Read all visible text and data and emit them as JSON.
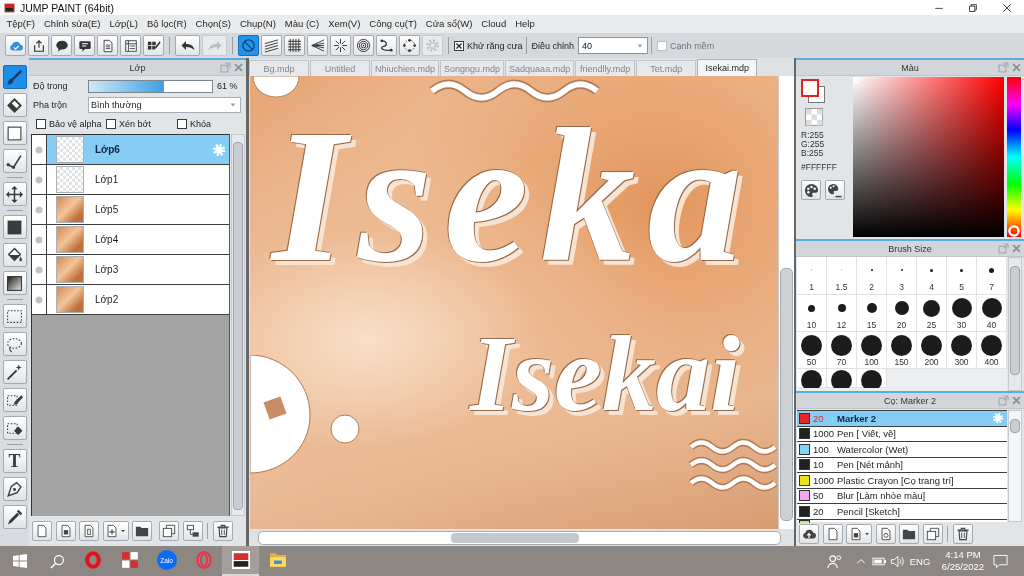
{
  "window": {
    "title": "JUMP PAINT (64bit)"
  },
  "menu": [
    "Tệp(F)",
    "Chỉnh sửa(E)",
    "Lớp(L)",
    "Bộ lọc(R)",
    "Chọn(S)",
    "Chụp(N)",
    "Màu (C)",
    "Xem(V)",
    "Công cụ(T)",
    "Cửa sổ(W)",
    "Cloud",
    "Help"
  ],
  "toolbar": {
    "history": [
      {
        "kind": "undo",
        "disabled": false
      },
      {
        "kind": "redo",
        "disabled": true
      }
    ],
    "ruler_tools": [
      {
        "kind": "off",
        "selected": true,
        "disabled": false
      },
      {
        "kind": "parallel",
        "selected": false,
        "disabled": false
      },
      {
        "kind": "grid",
        "selected": false,
        "disabled": false
      },
      {
        "kind": "focus",
        "selected": false,
        "disabled": false
      },
      {
        "kind": "radial",
        "selected": false,
        "disabled": false
      },
      {
        "kind": "concentric",
        "selected": false,
        "disabled": false
      },
      {
        "kind": "curve",
        "selected": false,
        "disabled": false
      },
      {
        "kind": "ellipse",
        "selected": false,
        "disabled": false
      },
      {
        "kind": "settings",
        "selected": false,
        "disabled": true
      }
    ],
    "antialias": {
      "label": "Khử răng cưa",
      "checked": true
    },
    "adjust": {
      "label": "Điều chỉnh",
      "value": "40"
    },
    "soft_edge": {
      "label": "Cạnh mềm",
      "checked": false,
      "disabled": true
    }
  },
  "tool_groups": [
    [
      {
        "kind": "brush",
        "selected": true
      },
      {
        "kind": "eraser",
        "selected": false
      },
      {
        "kind": "rect",
        "selected": false
      },
      {
        "kind": "polyline",
        "selected": false
      }
    ],
    [
      {
        "kind": "move",
        "selected": false
      }
    ],
    [
      {
        "kind": "fill_rect",
        "selected": false
      },
      {
        "kind": "bucket",
        "selected": false
      },
      {
        "kind": "gradient",
        "selected": false
      }
    ],
    [
      {
        "kind": "select_rect",
        "selected": false
      },
      {
        "kind": "lasso",
        "selected": false
      },
      {
        "kind": "wand",
        "selected": false
      },
      {
        "kind": "select_pen",
        "selected": false
      },
      {
        "kind": "select_eraser",
        "selected": false
      }
    ],
    [
      {
        "kind": "text",
        "glyph": "T",
        "selected": false
      },
      {
        "kind": "pen_nib",
        "selected": false
      },
      {
        "kind": "dropper",
        "selected": false
      }
    ]
  ],
  "layer_panel": {
    "title": "Lớp",
    "opacity": {
      "label": "Độ trong",
      "level": 0.61,
      "reading": "61 %"
    },
    "blend": {
      "label": "Pha trộn",
      "value": "Bình thường"
    },
    "options": [
      {
        "label": "Bảo vệ alpha",
        "checked": false
      },
      {
        "label": "Xén bớt",
        "checked": false
      },
      {
        "label": "Khóa",
        "checked": false
      }
    ],
    "layers": [
      {
        "name": "Lớp6",
        "kind": "empty",
        "selected": true
      },
      {
        "name": "Lớp1",
        "kind": "empty",
        "selected": false
      },
      {
        "name": "Lớp5",
        "kind": "image",
        "selected": false
      },
      {
        "name": "Lớp4",
        "kind": "image",
        "selected": false
      },
      {
        "name": "Lớp3",
        "kind": "image",
        "selected": false
      },
      {
        "name": "Lớp2",
        "kind": "image",
        "selected": false
      }
    ]
  },
  "tabs": [
    {
      "label": "Bg.mdp",
      "selected": false
    },
    {
      "label": "Untitled",
      "selected": false
    },
    {
      "label": "Nhiuchien.mdp",
      "selected": false
    },
    {
      "label": "Songngu.mdp",
      "selected": false
    },
    {
      "label": "Sadquaaa.mdp",
      "selected": false
    },
    {
      "label": "friendlly.mdp",
      "selected": false
    },
    {
      "label": "Tet.mdp",
      "selected": false
    },
    {
      "label": "Isekai.mdp",
      "selected": true
    }
  ],
  "artwork": {
    "lettering": [
      {
        "kind": "large",
        "text": "Iseka"
      },
      {
        "kind": "small",
        "text": "Isekai"
      }
    ]
  },
  "color_panel": {
    "title": "Màu",
    "channels": [
      "R:255",
      "G:255",
      "B:255"
    ],
    "hex": "#FFFFFF",
    "hue_slider": {
      "level": 0
    }
  },
  "brush_size_panel": {
    "title": "Brush Size",
    "sizes": [
      {
        "kind": "dot",
        "label": "1"
      },
      {
        "kind": "dot",
        "label": "1.5"
      },
      {
        "kind": "dot",
        "label": "2"
      },
      {
        "kind": "dot",
        "label": "3"
      },
      {
        "kind": "dot",
        "label": "4"
      },
      {
        "kind": "dot",
        "label": "5"
      },
      {
        "kind": "dot",
        "label": "7"
      },
      {
        "kind": "dot",
        "label": "10"
      },
      {
        "kind": "dot",
        "label": "12"
      },
      {
        "kind": "dot",
        "label": "15"
      },
      {
        "kind": "dot",
        "label": "20"
      },
      {
        "kind": "dot",
        "label": "25"
      },
      {
        "kind": "dot",
        "label": "30"
      },
      {
        "kind": "dot",
        "label": "40"
      },
      {
        "kind": "dot",
        "label": "50"
      },
      {
        "kind": "dot",
        "label": "70"
      },
      {
        "kind": "dot",
        "label": "100"
      },
      {
        "kind": "dot",
        "label": "150"
      },
      {
        "kind": "dot",
        "label": "200"
      },
      {
        "kind": "dot",
        "label": "300"
      },
      {
        "kind": "dot",
        "label": "400"
      },
      {
        "kind": "cut"
      },
      {
        "kind": "cut"
      },
      {
        "kind": "cut"
      }
    ]
  },
  "brush_panel": {
    "title": "Cọ: Marker 2",
    "brushes": [
      {
        "kind": "full",
        "size": "20",
        "name": "Marker 2",
        "color": "#e8262a",
        "selected": true
      },
      {
        "kind": "full",
        "size": "1000",
        "name": "Pen [ Viết, vẽ]",
        "color": "#222222",
        "selected": false
      },
      {
        "kind": "full",
        "size": "100",
        "name": "Watercolor (Wet)",
        "color": "#7ed6f4",
        "selected": false
      },
      {
        "kind": "full",
        "size": "10",
        "name": "Pen [Nét mảnh]",
        "color": "#222222",
        "selected": false
      },
      {
        "kind": "full",
        "size": "1000",
        "name": "Plastic Crayon [Cọ trang trí]",
        "color": "#ece21c",
        "selected": false
      },
      {
        "kind": "full",
        "size": "50",
        "name": "Blur [Làm nhòe màu]",
        "color": "#f7a6f4",
        "selected": false
      },
      {
        "kind": "full",
        "size": "20",
        "name": "Pencil [Sketch]",
        "color": "#222222",
        "selected": false
      },
      {
        "kind": "cut",
        "color": "#c9e08e",
        "selected": false
      }
    ]
  },
  "taskbar": {
    "apps": [
      {
        "kind": "o",
        "selected": false
      },
      {
        "kind": "tiles",
        "selected": false
      },
      {
        "kind": "chat",
        "label": "Zalo",
        "selected": false
      },
      {
        "kind": "ring",
        "selected": false
      },
      {
        "kind": "paint",
        "selected": true
      },
      {
        "kind": "folder",
        "selected": false
      }
    ],
    "language": "ENG",
    "time": "4:14 PM",
    "date": "6/25/2022"
  }
}
